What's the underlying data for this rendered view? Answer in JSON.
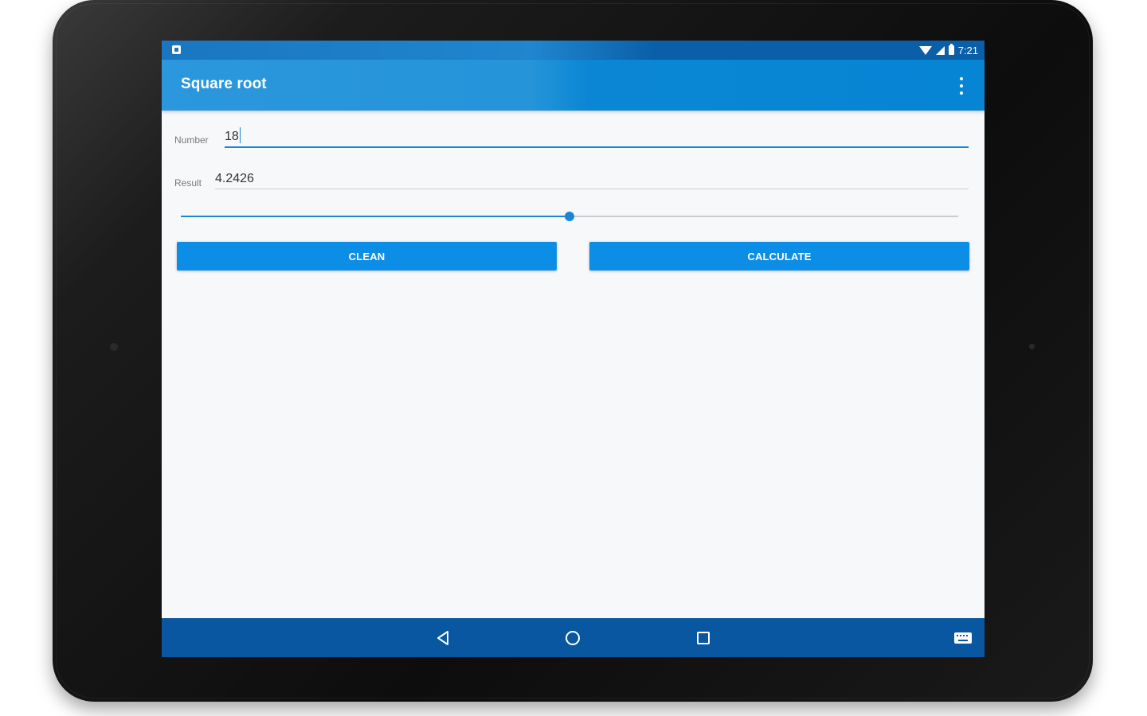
{
  "status_bar": {
    "time": "7:21"
  },
  "toolbar": {
    "title": "Square root",
    "overflow_icon": "more-vert-icon"
  },
  "form": {
    "number_label": "Number",
    "number_value": "18",
    "result_label": "Result",
    "result_value": "4.2426"
  },
  "slider": {
    "value_fraction": 0.5
  },
  "buttons": {
    "clean_label": "CLEAN",
    "calculate_label": "CALCULATE"
  },
  "nav_bar": {
    "icons": [
      "back-icon",
      "home-icon",
      "recent-apps-icon",
      "keyboard-icon"
    ]
  },
  "colors": {
    "primary": "#2594d9",
    "primary_dark": "#0a57a1",
    "accent": "#1a86d4",
    "button": "#0d8ee6",
    "background": "#f7f8fa"
  }
}
